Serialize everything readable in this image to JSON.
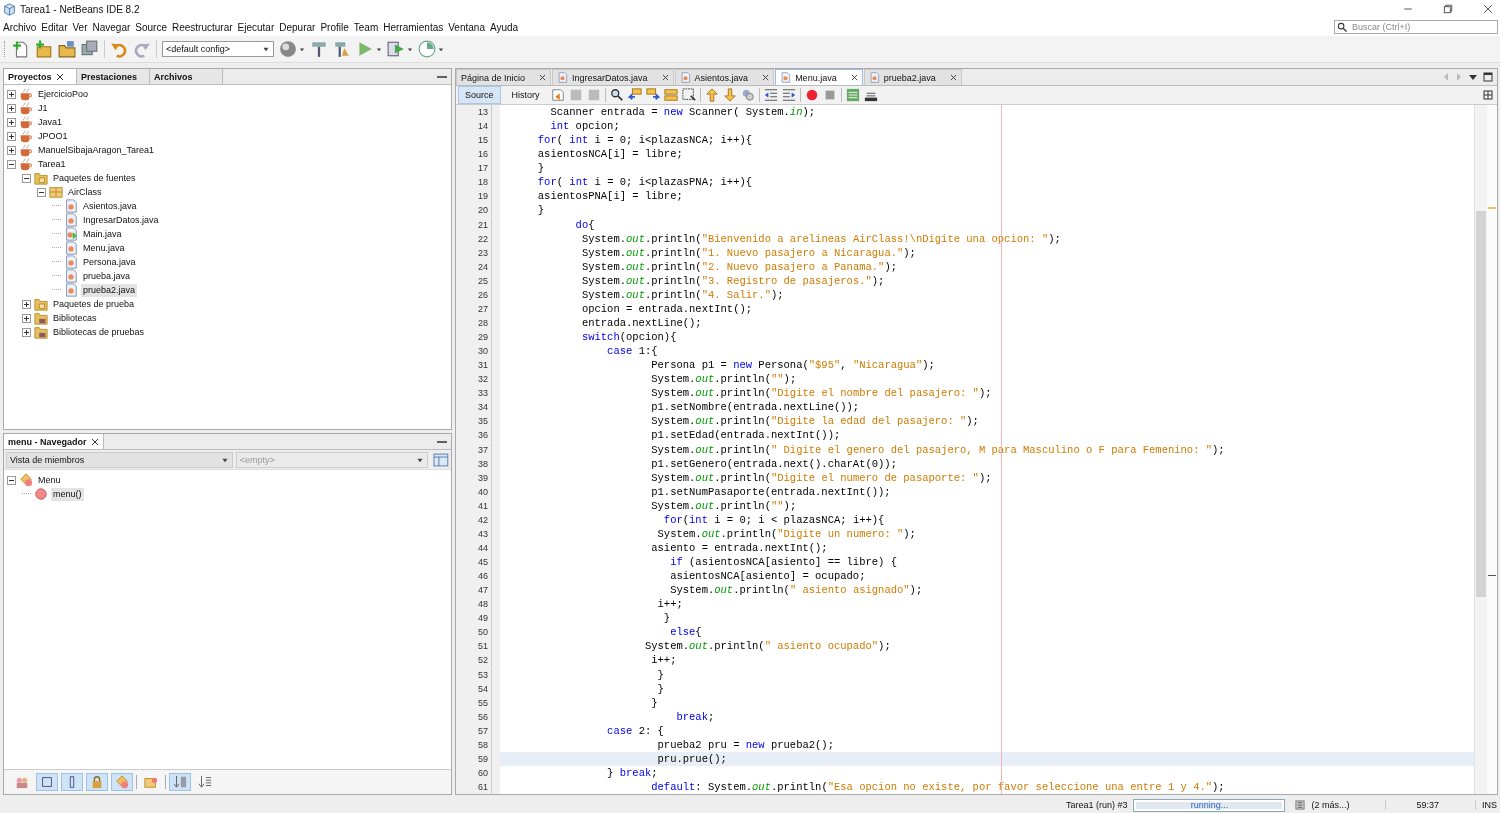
{
  "window": {
    "title": "Tarea1 - NetBeans IDE 8.2"
  },
  "menu": [
    "Archivo",
    "Editar",
    "Ver",
    "Navegar",
    "Source",
    "Reestructurar",
    "Ejecutar",
    "Depurar",
    "Profile",
    "Team",
    "Herramientas",
    "Ventana",
    "Ayuda"
  ],
  "search": {
    "placeholder": "Buscar (Ctrl+I)"
  },
  "toolbar": {
    "config": "<default config>"
  },
  "projects_panel": {
    "tabs": [
      {
        "label": "Proyectos",
        "selected": true
      },
      {
        "label": "Prestaciones",
        "selected": false
      },
      {
        "label": "Archivos",
        "selected": false
      }
    ],
    "tree": [
      {
        "label": "EjercicioPoo",
        "kind": "project",
        "expanded": false,
        "selected": false
      },
      {
        "label": "J1",
        "kind": "project",
        "expanded": false,
        "selected": false
      },
      {
        "label": "Java1",
        "kind": "project",
        "expanded": false,
        "selected": false
      },
      {
        "label": "JPOO1",
        "kind": "project",
        "expanded": false,
        "selected": false
      },
      {
        "label": "ManuelSibajaAragon_Tarea1",
        "kind": "project",
        "expanded": false,
        "selected": false
      },
      {
        "label": "Tarea1",
        "kind": "project",
        "expanded": true,
        "selected": false,
        "children": [
          {
            "label": "Paquetes de fuentes",
            "kind": "folder",
            "expanded": true,
            "selected": false,
            "children": [
              {
                "label": "AirClass",
                "kind": "package",
                "expanded": true,
                "selected": false,
                "children": [
                  {
                    "label": "Asientos.java",
                    "kind": "java",
                    "selected": false
                  },
                  {
                    "label": "IngresarDatos.java",
                    "kind": "java",
                    "selected": false
                  },
                  {
                    "label": "Main.java",
                    "kind": "java-main",
                    "selected": false
                  },
                  {
                    "label": "Menu.java",
                    "kind": "java",
                    "selected": false
                  },
                  {
                    "label": "Persona.java",
                    "kind": "java",
                    "selected": false
                  },
                  {
                    "label": "prueba.java",
                    "kind": "java",
                    "selected": false
                  },
                  {
                    "label": "prueba2.java",
                    "kind": "java",
                    "selected": true
                  }
                ]
              }
            ]
          },
          {
            "label": "Paquetes de prueba",
            "kind": "folder",
            "expanded": false,
            "selected": false
          },
          {
            "label": "Bibliotecas",
            "kind": "library",
            "expanded": false,
            "selected": false
          },
          {
            "label": "Bibliotecas de pruebas",
            "kind": "library",
            "expanded": false,
            "selected": false
          }
        ]
      }
    ]
  },
  "navigator": {
    "title": "menu - Navegador",
    "view": "Vista de miembros",
    "filter": "<empty>",
    "tree": [
      {
        "label": "Menu",
        "kind": "class",
        "expanded": true,
        "selected": false,
        "children": [
          {
            "label": "menu()",
            "kind": "method",
            "selected": true
          }
        ]
      }
    ],
    "filters": [
      {
        "kind": "inherited",
        "on": false
      },
      {
        "kind": "fields",
        "on": true
      },
      {
        "kind": "static",
        "on": true
      },
      {
        "kind": "nonpublic",
        "on": true
      },
      {
        "kind": "local",
        "on": true
      },
      {
        "kind": "javadoc",
        "on": false
      },
      {
        "kind": "sort-name",
        "on": true
      },
      {
        "kind": "sort-source",
        "on": false
      }
    ]
  },
  "editor": {
    "tabs": [
      {
        "label": "Página de Inicio",
        "kind": "start",
        "selected": false
      },
      {
        "label": "IngresarDatos.java",
        "kind": "java",
        "selected": false
      },
      {
        "label": "Asientos.java",
        "kind": "java",
        "selected": false
      },
      {
        "label": "Menu.java",
        "kind": "java",
        "selected": true
      },
      {
        "label": "prueba2.java",
        "kind": "java",
        "selected": false
      }
    ],
    "views": [
      {
        "label": "Source",
        "selected": true
      },
      {
        "label": "History",
        "selected": false
      }
    ],
    "lines": [
      {
        "number": "13",
        "current": false,
        "tokens": [
          {
            "kind": "plain",
            "text": "        Scanner entrada = "
          },
          {
            "kind": "keyword",
            "text": "new"
          },
          {
            "kind": "plain",
            "text": " Scanner( System."
          },
          {
            "kind": "field",
            "text": "in"
          },
          {
            "kind": "plain",
            "text": ");"
          }
        ]
      },
      {
        "number": "14",
        "current": false,
        "tokens": [
          {
            "kind": "keyword",
            "text": "        int"
          },
          {
            "kind": "plain",
            "text": " opcion;"
          }
        ]
      },
      {
        "number": "15",
        "current": false,
        "tokens": [
          {
            "kind": "keyword",
            "text": "      for"
          },
          {
            "kind": "plain",
            "text": "( "
          },
          {
            "kind": "keyword",
            "text": "int"
          },
          {
            "kind": "plain",
            "text": " i = 0; i<plazasNCA; i++){"
          }
        ]
      },
      {
        "number": "16",
        "current": false,
        "tokens": [
          {
            "kind": "plain",
            "text": "      asientosNCA[i] = libre;"
          }
        ]
      },
      {
        "number": "17",
        "current": false,
        "tokens": [
          {
            "kind": "plain",
            "text": "      }"
          }
        ]
      },
      {
        "number": "18",
        "current": false,
        "tokens": [
          {
            "kind": "keyword",
            "text": "      for"
          },
          {
            "kind": "plain",
            "text": "( "
          },
          {
            "kind": "keyword",
            "text": "int"
          },
          {
            "kind": "plain",
            "text": " i = 0; i<plazasPNA; i++){"
          }
        ]
      },
      {
        "number": "19",
        "current": false,
        "tokens": [
          {
            "kind": "plain",
            "text": "      asientosPNA[i] = libre;"
          }
        ]
      },
      {
        "number": "20",
        "current": false,
        "tokens": [
          {
            "kind": "plain",
            "text": "      }"
          }
        ]
      },
      {
        "number": "21",
        "current": false,
        "tokens": [
          {
            "kind": "keyword",
            "text": "            do"
          },
          {
            "kind": "plain",
            "text": "{"
          }
        ]
      },
      {
        "number": "22",
        "current": false,
        "tokens": [
          {
            "kind": "plain",
            "text": "             System."
          },
          {
            "kind": "field",
            "text": "out"
          },
          {
            "kind": "plain",
            "text": ".println("
          },
          {
            "kind": "string",
            "text": "\"Bienvenido a arelineas AirClass!\\nDigite una opcion: \""
          },
          {
            "kind": "plain",
            "text": ");"
          }
        ]
      },
      {
        "number": "23",
        "current": false,
        "tokens": [
          {
            "kind": "plain",
            "text": "             System."
          },
          {
            "kind": "field",
            "text": "out"
          },
          {
            "kind": "plain",
            "text": ".println("
          },
          {
            "kind": "string",
            "text": "\"1. Nuevo pasajero a Nicaragua.\""
          },
          {
            "kind": "plain",
            "text": ");"
          }
        ]
      },
      {
        "number": "24",
        "current": false,
        "tokens": [
          {
            "kind": "plain",
            "text": "             System."
          },
          {
            "kind": "field",
            "text": "out"
          },
          {
            "kind": "plain",
            "text": ".println("
          },
          {
            "kind": "string",
            "text": "\"2. Nuevo pasajero a Panama.\""
          },
          {
            "kind": "plain",
            "text": ");"
          }
        ]
      },
      {
        "number": "25",
        "current": false,
        "tokens": [
          {
            "kind": "plain",
            "text": "             System."
          },
          {
            "kind": "field",
            "text": "out"
          },
          {
            "kind": "plain",
            "text": ".println("
          },
          {
            "kind": "string",
            "text": "\"3. Registro de pasajeros.\""
          },
          {
            "kind": "plain",
            "text": ");"
          }
        ]
      },
      {
        "number": "26",
        "current": false,
        "tokens": [
          {
            "kind": "plain",
            "text": "             System."
          },
          {
            "kind": "field",
            "text": "out"
          },
          {
            "kind": "plain",
            "text": ".println("
          },
          {
            "kind": "string",
            "text": "\"4. Salir.\""
          },
          {
            "kind": "plain",
            "text": ");"
          }
        ]
      },
      {
        "number": "27",
        "current": false,
        "tokens": [
          {
            "kind": "plain",
            "text": "             opcion = entrada.nextInt();"
          }
        ]
      },
      {
        "number": "28",
        "current": false,
        "tokens": [
          {
            "kind": "plain",
            "text": "             entrada.nextLine();"
          }
        ]
      },
      {
        "number": "29",
        "current": false,
        "tokens": [
          {
            "kind": "keyword",
            "text": "             switch"
          },
          {
            "kind": "plain",
            "text": "(opcion){"
          }
        ]
      },
      {
        "number": "30",
        "current": false,
        "tokens": [
          {
            "kind": "keyword",
            "text": "                 case"
          },
          {
            "kind": "plain",
            "text": " 1:{"
          }
        ]
      },
      {
        "number": "31",
        "current": false,
        "tokens": [
          {
            "kind": "plain",
            "text": "                        Persona p1 = "
          },
          {
            "kind": "keyword",
            "text": "new"
          },
          {
            "kind": "plain",
            "text": " Persona("
          },
          {
            "kind": "string",
            "text": "\"$95\""
          },
          {
            "kind": "plain",
            "text": ", "
          },
          {
            "kind": "string",
            "text": "\"Nicaragua\""
          },
          {
            "kind": "plain",
            "text": ");"
          }
        ]
      },
      {
        "number": "32",
        "current": false,
        "tokens": [
          {
            "kind": "plain",
            "text": "                        System."
          },
          {
            "kind": "field",
            "text": "out"
          },
          {
            "kind": "plain",
            "text": ".println("
          },
          {
            "kind": "string",
            "text": "\"\""
          },
          {
            "kind": "plain",
            "text": ");"
          }
        ]
      },
      {
        "number": "33",
        "current": false,
        "tokens": [
          {
            "kind": "plain",
            "text": "                        System."
          },
          {
            "kind": "field",
            "text": "out"
          },
          {
            "kind": "plain",
            "text": ".println("
          },
          {
            "kind": "string",
            "text": "\"Digite el nombre del pasajero: \""
          },
          {
            "kind": "plain",
            "text": ");"
          }
        ]
      },
      {
        "number": "34",
        "current": false,
        "tokens": [
          {
            "kind": "plain",
            "text": "                        p1.setNombre(entrada.nextLine());"
          }
        ]
      },
      {
        "number": "35",
        "current": false,
        "tokens": [
          {
            "kind": "plain",
            "text": "                        System."
          },
          {
            "kind": "field",
            "text": "out"
          },
          {
            "kind": "plain",
            "text": ".println("
          },
          {
            "kind": "string",
            "text": "\"Digite la edad del pasajero: \""
          },
          {
            "kind": "plain",
            "text": ");"
          }
        ]
      },
      {
        "number": "36",
        "current": false,
        "tokens": [
          {
            "kind": "plain",
            "text": "                        p1.setEdad(entrada.nextInt());"
          }
        ]
      },
      {
        "number": "37",
        "current": false,
        "tokens": [
          {
            "kind": "plain",
            "text": "                        System."
          },
          {
            "kind": "field",
            "text": "out"
          },
          {
            "kind": "plain",
            "text": ".println("
          },
          {
            "kind": "string",
            "text": "\" Digite el genero del pasajero, M para Masculino o F para Femenino: \""
          },
          {
            "kind": "plain",
            "text": ");"
          }
        ]
      },
      {
        "number": "38",
        "current": false,
        "tokens": [
          {
            "kind": "plain",
            "text": "                        p1.setGenero(entrada.next().charAt(0));"
          }
        ]
      },
      {
        "number": "39",
        "current": false,
        "tokens": [
          {
            "kind": "plain",
            "text": "                        System."
          },
          {
            "kind": "field",
            "text": "out"
          },
          {
            "kind": "plain",
            "text": ".println("
          },
          {
            "kind": "string",
            "text": "\"Digite el numero de pasaporte: \""
          },
          {
            "kind": "plain",
            "text": ");"
          }
        ]
      },
      {
        "number": "40",
        "current": false,
        "tokens": [
          {
            "kind": "plain",
            "text": "                        p1.setNumPasaporte(entrada.nextInt());"
          }
        ]
      },
      {
        "number": "41",
        "current": false,
        "tokens": [
          {
            "kind": "plain",
            "text": "                        System."
          },
          {
            "kind": "field",
            "text": "out"
          },
          {
            "kind": "plain",
            "text": ".println("
          },
          {
            "kind": "string",
            "text": "\"\""
          },
          {
            "kind": "plain",
            "text": ");"
          }
        ]
      },
      {
        "number": "42",
        "current": false,
        "tokens": [
          {
            "kind": "keyword",
            "text": "                          for"
          },
          {
            "kind": "plain",
            "text": "("
          },
          {
            "kind": "keyword",
            "text": "int"
          },
          {
            "kind": "plain",
            "text": " i = 0; i < plazasNCA; i++){"
          }
        ]
      },
      {
        "number": "43",
        "current": false,
        "tokens": [
          {
            "kind": "plain",
            "text": "                         System."
          },
          {
            "kind": "field",
            "text": "out"
          },
          {
            "kind": "plain",
            "text": ".println("
          },
          {
            "kind": "string",
            "text": "\"Digite un numero: \""
          },
          {
            "kind": "plain",
            "text": ");"
          }
        ]
      },
      {
        "number": "44",
        "current": false,
        "tokens": [
          {
            "kind": "plain",
            "text": "                        asiento = entrada.nextInt();"
          }
        ]
      },
      {
        "number": "45",
        "current": false,
        "tokens": [
          {
            "kind": "keyword",
            "text": "                           if"
          },
          {
            "kind": "plain",
            "text": " (asientosNCA[asiento] == libre) {"
          }
        ]
      },
      {
        "number": "46",
        "current": false,
        "tokens": [
          {
            "kind": "plain",
            "text": "                           asientosNCA[asiento] = ocupado;"
          }
        ]
      },
      {
        "number": "47",
        "current": false,
        "tokens": [
          {
            "kind": "plain",
            "text": "                           System."
          },
          {
            "kind": "field",
            "text": "out"
          },
          {
            "kind": "plain",
            "text": ".println("
          },
          {
            "kind": "string",
            "text": "\" asiento asignado\""
          },
          {
            "kind": "plain",
            "text": ");"
          }
        ]
      },
      {
        "number": "48",
        "current": false,
        "tokens": [
          {
            "kind": "plain",
            "text": "                         i++;"
          }
        ]
      },
      {
        "number": "49",
        "current": false,
        "tokens": [
          {
            "kind": "plain",
            "text": "                          }"
          }
        ]
      },
      {
        "number": "50",
        "current": false,
        "tokens": [
          {
            "kind": "keyword",
            "text": "                           else"
          },
          {
            "kind": "plain",
            "text": "{"
          }
        ]
      },
      {
        "number": "51",
        "current": false,
        "tokens": [
          {
            "kind": "plain",
            "text": "                       System."
          },
          {
            "kind": "field",
            "text": "out"
          },
          {
            "kind": "plain",
            "text": ".println("
          },
          {
            "kind": "string",
            "text": "\" asiento ocupado\""
          },
          {
            "kind": "plain",
            "text": ");"
          }
        ]
      },
      {
        "number": "52",
        "current": false,
        "tokens": [
          {
            "kind": "plain",
            "text": "                        i++;"
          }
        ]
      },
      {
        "number": "53",
        "current": false,
        "tokens": [
          {
            "kind": "plain",
            "text": "                         }"
          }
        ]
      },
      {
        "number": "54",
        "current": false,
        "tokens": [
          {
            "kind": "plain",
            "text": "                         }"
          }
        ]
      },
      {
        "number": "55",
        "current": false,
        "tokens": [
          {
            "kind": "plain",
            "text": "                        }"
          }
        ]
      },
      {
        "number": "56",
        "current": false,
        "tokens": [
          {
            "kind": "keyword",
            "text": "                            break"
          },
          {
            "kind": "plain",
            "text": ";"
          }
        ]
      },
      {
        "number": "57",
        "current": false,
        "tokens": [
          {
            "kind": "keyword",
            "text": "                 case"
          },
          {
            "kind": "plain",
            "text": " 2: {"
          }
        ]
      },
      {
        "number": "58",
        "current": false,
        "tokens": [
          {
            "kind": "plain",
            "text": "                         prueba2 pru = "
          },
          {
            "kind": "keyword",
            "text": "new"
          },
          {
            "kind": "plain",
            "text": " prueba2();"
          }
        ]
      },
      {
        "number": "59",
        "current": true,
        "tokens": [
          {
            "kind": "plain",
            "text": "                         pru.prue();"
          }
        ]
      },
      {
        "number": "60",
        "current": false,
        "tokens": [
          {
            "kind": "plain",
            "text": "                 } "
          },
          {
            "kind": "keyword",
            "text": "break"
          },
          {
            "kind": "plain",
            "text": ";"
          }
        ]
      },
      {
        "number": "61",
        "current": false,
        "tokens": [
          {
            "kind": "keyword",
            "text": "                        default"
          },
          {
            "kind": "plain",
            "text": ": System."
          },
          {
            "kind": "field",
            "text": "out"
          },
          {
            "kind": "plain",
            "text": ".println("
          },
          {
            "kind": "string",
            "text": "\"Esa opcion no existe, por favor seleccione una entre 1 y 4.\""
          },
          {
            "kind": "plain",
            "text": ");"
          }
        ]
      }
    ]
  },
  "status_bar": {
    "task": "Tarea1 (run) #3",
    "progress": {
      "label": "running...",
      "level": 1
    },
    "more": "(2 más...)",
    "position": "59:37",
    "mode": "INS"
  }
}
